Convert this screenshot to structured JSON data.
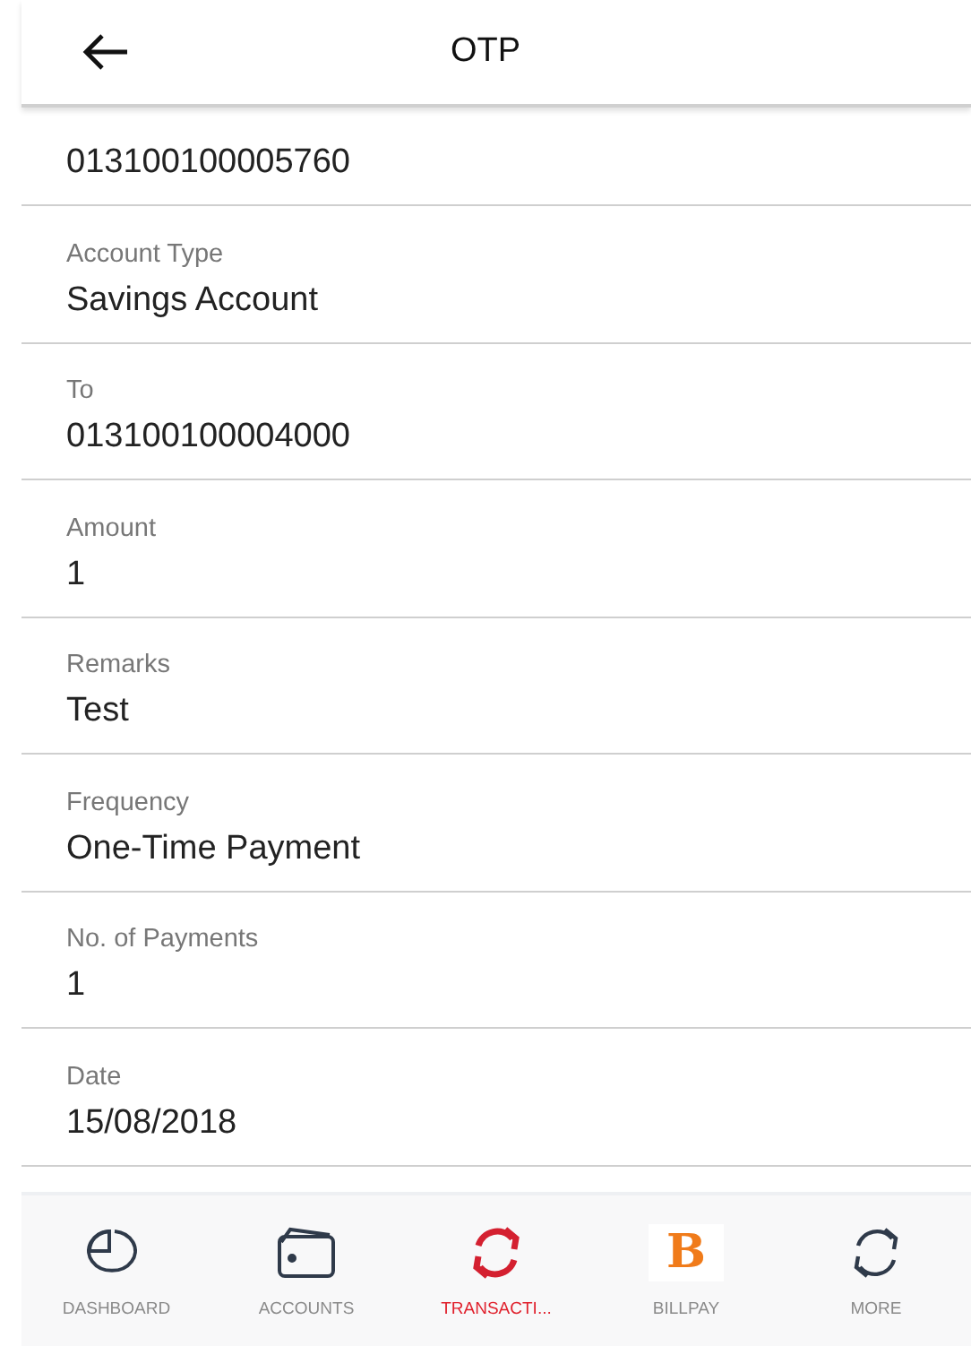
{
  "header": {
    "title": "OTP"
  },
  "fields": [
    {
      "value": "013100100005760"
    },
    {
      "label": "Account Type",
      "value": "Savings Account"
    },
    {
      "label": "To",
      "value": "013100100004000"
    },
    {
      "label": "Amount",
      "value": "1"
    },
    {
      "label": "Remarks",
      "value": "Test"
    },
    {
      "label": "Frequency",
      "value": "One-Time Payment"
    },
    {
      "label": "No. of Payments",
      "value": "1"
    },
    {
      "label": "Date",
      "value": "15/08/2018"
    }
  ],
  "nav": [
    {
      "kind": "dashboard",
      "label": "DASHBOARD",
      "selected": false
    },
    {
      "kind": "accounts",
      "label": "ACCOUNTS",
      "selected": false
    },
    {
      "kind": "transactions",
      "label": "TRANSACTI...",
      "selected": true
    },
    {
      "kind": "billpay",
      "label": "BILLPAY",
      "logo": "B",
      "selected": false
    },
    {
      "kind": "more",
      "label": "MORE",
      "selected": false
    }
  ]
}
